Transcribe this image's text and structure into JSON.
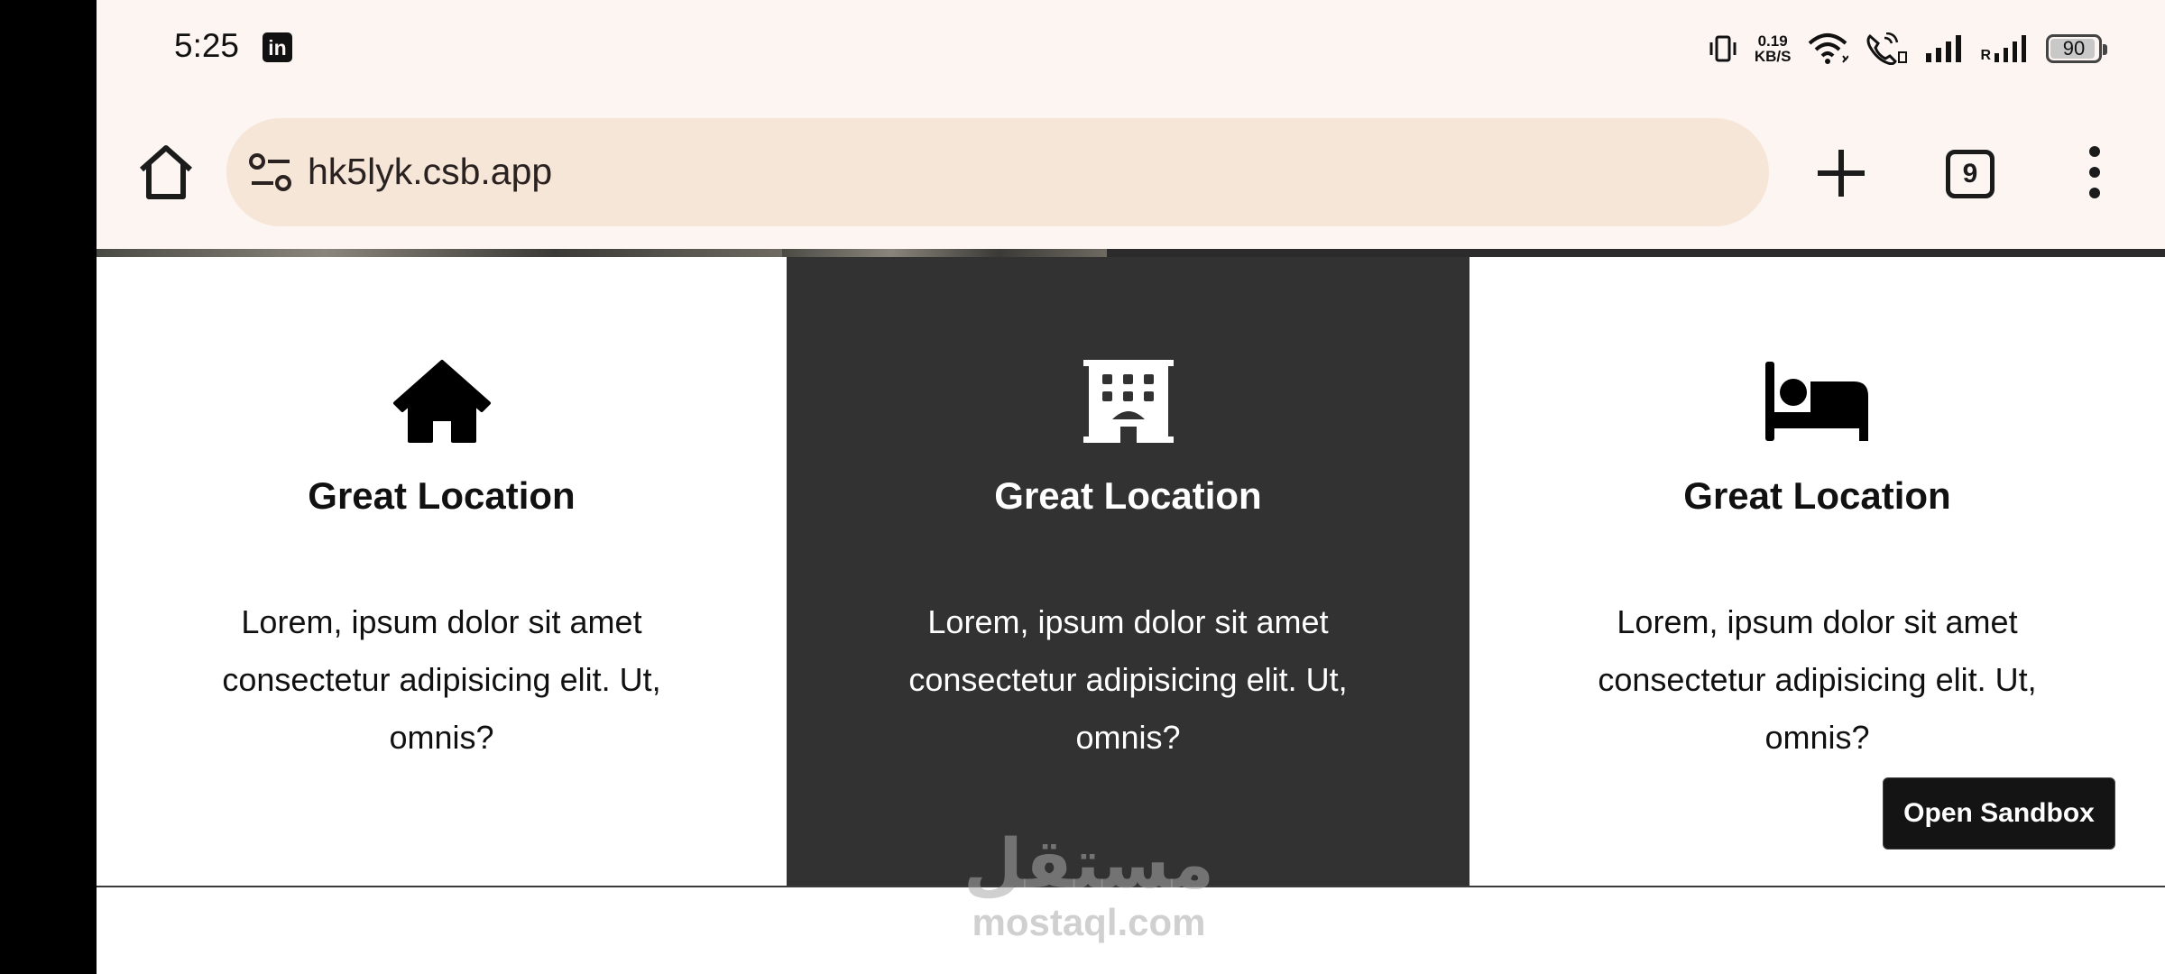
{
  "status_bar": {
    "time": "5:25",
    "notification_icon": "linkedin-icon",
    "notification_letters": "in",
    "net_speed_value": "0.19",
    "net_speed_unit": "KB/S",
    "roaming_label": "R",
    "battery_level": "90",
    "icons": [
      "vibrate-icon",
      "wifi-icon",
      "wifi-calling-icon",
      "signal-icon",
      "signal-roaming-icon",
      "battery-icon"
    ]
  },
  "browser": {
    "url": "hk5lyk.csb.app",
    "tab_count": "9",
    "icons": [
      "home-icon",
      "site-settings-icon",
      "plus-icon",
      "tabs-icon",
      "more-vertical-icon"
    ]
  },
  "features": [
    {
      "icon": "house-icon",
      "title": "Great Location",
      "text": "Lorem, ipsum dolor sit amet consectetur adipisicing elit. Ut, omnis?",
      "theme": "light"
    },
    {
      "icon": "building-icon",
      "title": "Great Location",
      "text": "Lorem, ipsum dolor sit amet consectetur adipisicing elit. Ut, omnis?",
      "theme": "dark"
    },
    {
      "icon": "bed-icon",
      "title": "Great Location",
      "text": "Lorem, ipsum dolor sit amet consectetur adipisicing elit. Ut, omnis?",
      "theme": "light"
    }
  ],
  "sandbox_button": {
    "label": "Open Sandbox"
  },
  "watermark": {
    "arabic": "مستقل",
    "latin": "mostaql.com"
  },
  "colors": {
    "status_bg": "#fdf5f2",
    "omnibox_bg": "#f6e6d8",
    "dark_card": "#323232",
    "button_bg": "#141414"
  }
}
